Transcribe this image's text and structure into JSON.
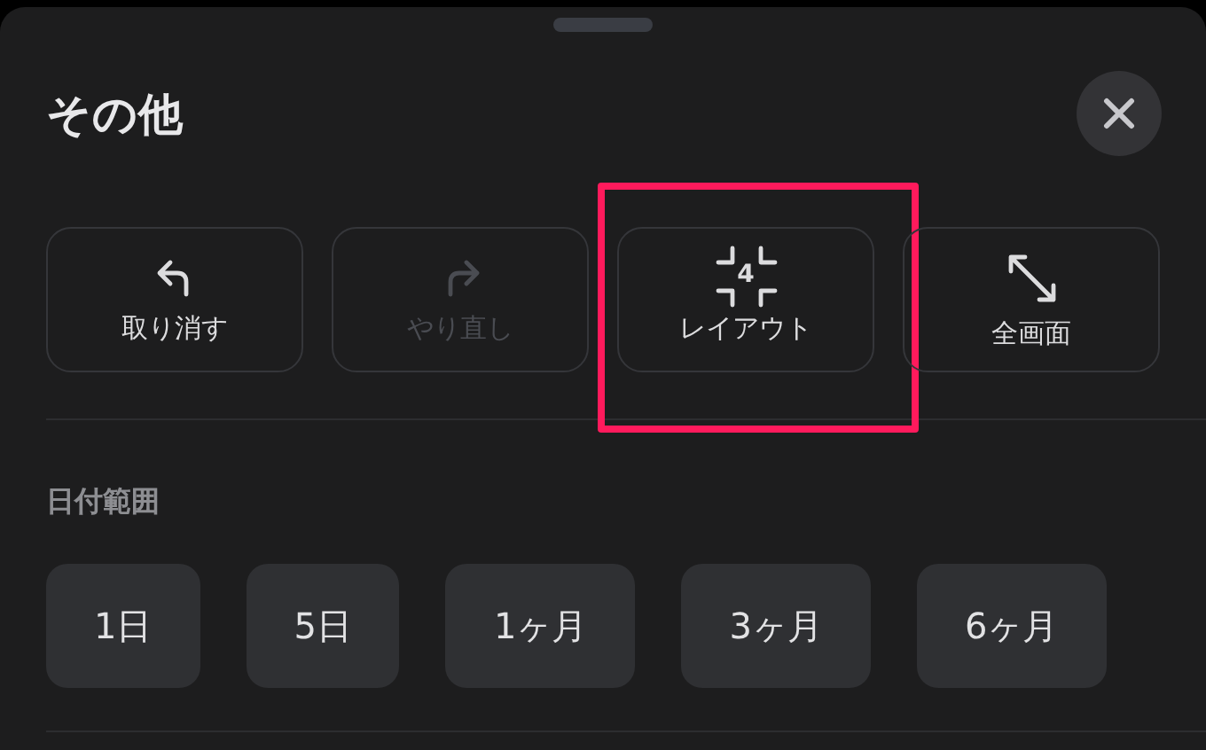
{
  "sheet": {
    "title": "その他"
  },
  "actions": [
    {
      "kind": "undo",
      "label": "取り消す",
      "disabled": false,
      "highlighted": false
    },
    {
      "kind": "redo",
      "label": "やり直し",
      "disabled": true,
      "highlighted": false
    },
    {
      "kind": "layout",
      "label": "レイアウト",
      "icon_text": "4",
      "disabled": false,
      "highlighted": true
    },
    {
      "kind": "fullscreen",
      "label": "全画面",
      "disabled": false,
      "highlighted": false
    }
  ],
  "date_range": {
    "label": "日付範囲",
    "options": [
      {
        "label": "1日",
        "selected": false
      },
      {
        "label": "5日",
        "selected": false
      },
      {
        "label": "1ヶ月",
        "selected": false
      },
      {
        "label": "3ヶ月",
        "selected": false
      },
      {
        "label": "6ヶ月",
        "selected": false
      }
    ]
  }
}
